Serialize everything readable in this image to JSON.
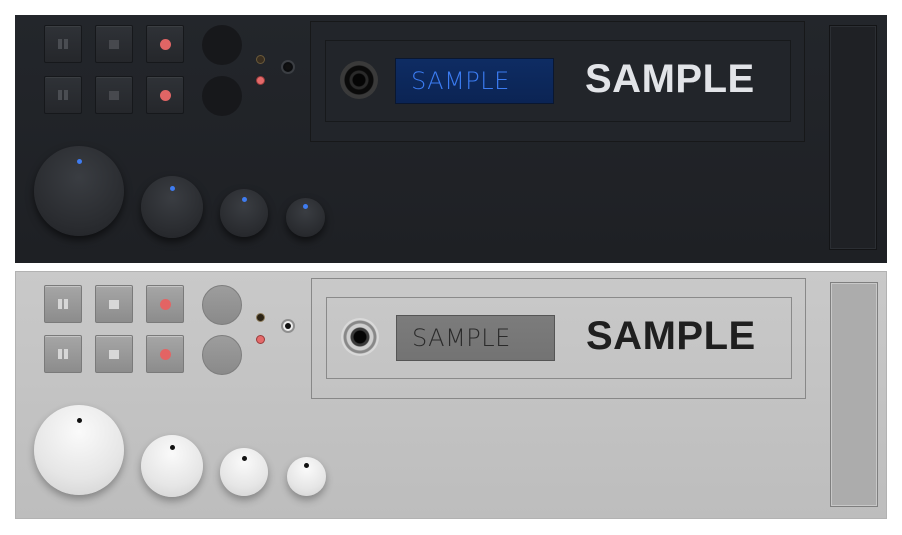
{
  "panels": [
    {
      "theme": "dark",
      "display": {
        "lcd_text": "SAMPLE",
        "label": "SAMPLE"
      },
      "lcd_color": "#3b7cf2",
      "knob_indicator_color": "#3f7cf0",
      "buttons": [
        "pause-icon",
        "stop-icon",
        "record-icon",
        "pause-icon",
        "stop-icon",
        "record-icon"
      ]
    },
    {
      "theme": "light",
      "display": {
        "lcd_text": "SAMPLE",
        "label": "SAMPLE"
      },
      "lcd_color": "#2a2a2a",
      "knob_indicator_color": "#111111",
      "buttons": [
        "pause-icon",
        "stop-icon",
        "record-icon",
        "pause-icon",
        "stop-icon",
        "record-icon"
      ]
    }
  ],
  "colors": {
    "record_red": "#e36464",
    "dark_panel": "#23262b",
    "light_panel": "#c4c4c4"
  }
}
